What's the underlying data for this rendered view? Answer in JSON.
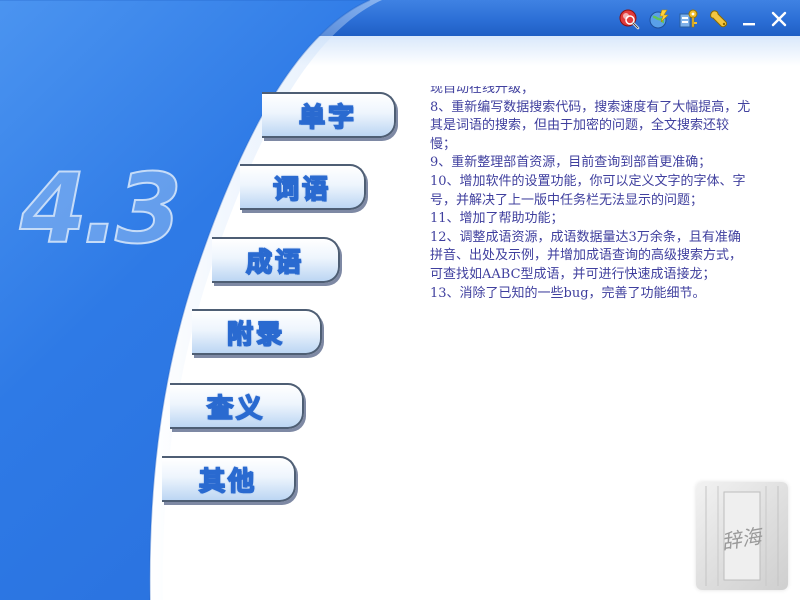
{
  "app": {
    "version_watermark": "4.3"
  },
  "nav": {
    "items": [
      {
        "label": "单字"
      },
      {
        "label": "词语"
      },
      {
        "label": "成语"
      },
      {
        "label": "附录"
      },
      {
        "label": "查义"
      },
      {
        "label": "其他"
      }
    ]
  },
  "toolbar": {
    "icons": [
      "search-globe-icon",
      "update-globe-icon",
      "key-icon",
      "settings-wrench-icon"
    ],
    "minimize_label": "_",
    "close_label": "✕"
  },
  "content": {
    "lines": [
      "现自动在线升级；",
      "8、重新编写数据搜索代码，搜索速度有了大幅提高，尤其是词语的搜索，但由于加密的问题，全文搜索还较慢；",
      "9、重新整理部首资源，目前查询到部首更准确；",
      "10、增加软件的设置功能，你可以定义文字的字体、字号，并解决了上一版中任务栏无法显示的问题；",
      "11、增加了帮助功能；",
      "12、调整成语资源，成语数据量达3万余条，且有准确拼音、出处及示例，并增加成语查询的高级搜索方式，可查找如AABC型成语，并可进行快速成语接龙；",
      "13、消除了已知的一些bug，完善了功能细节。"
    ]
  },
  "stamp": {
    "text": "辞海"
  },
  "colors": {
    "panel_blue": "#2f7ee8",
    "panel_blue_dark": "#1b5fcc",
    "text_purple": "#3f3f9e",
    "tab_text_outline": "#2a6ad0"
  }
}
